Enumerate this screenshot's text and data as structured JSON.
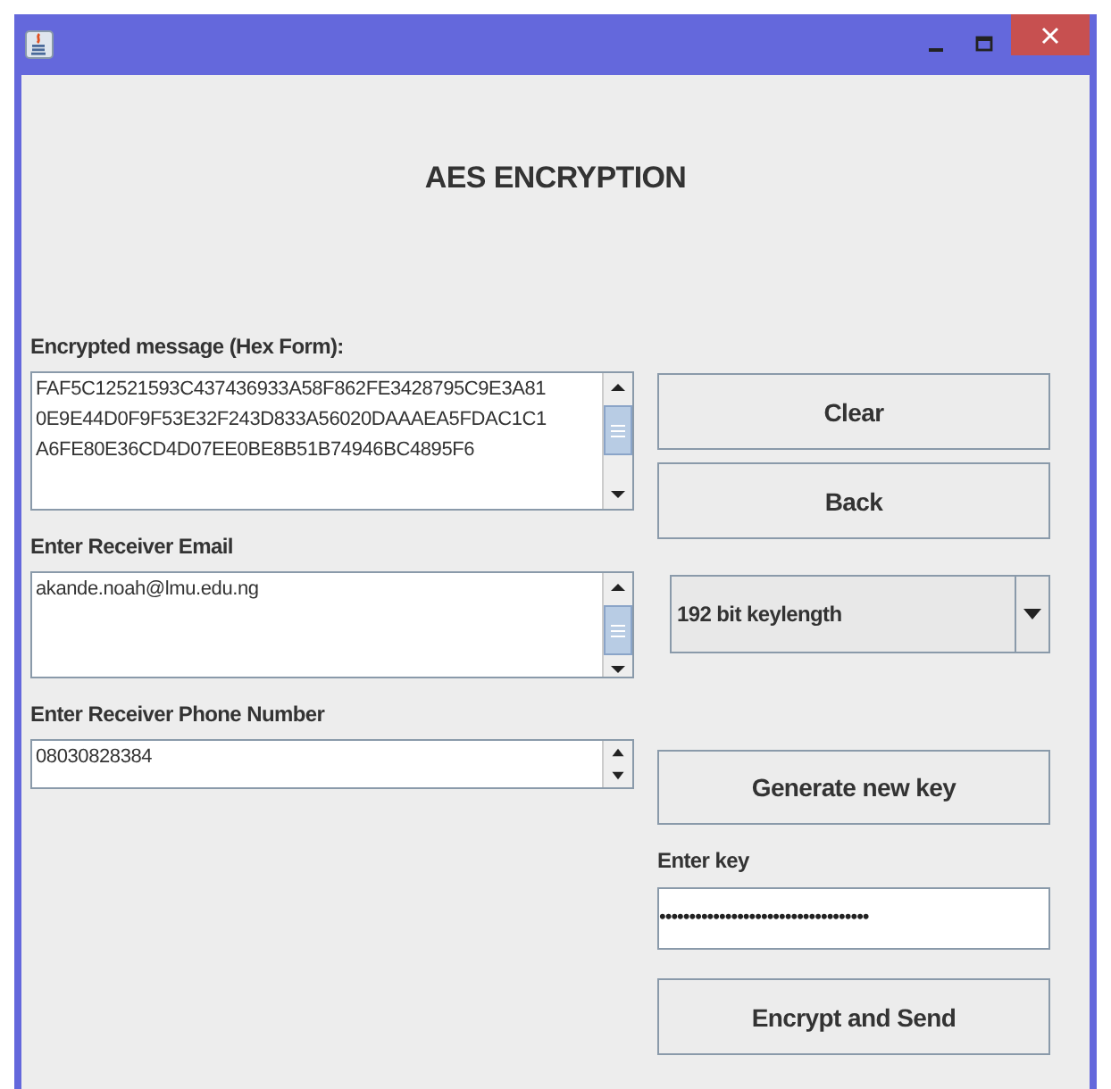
{
  "heading": "AES ENCRYPTION",
  "fields": [
    {
      "kind": "textarea",
      "label": "Encrypted message (Hex Form):",
      "lines": [
        "FAF5C12521593C437436933A58F862FE3428795C9E3A81",
        "0E9E44D0F9F53E32F243D833A56020DAAAEA5FDAC1C1",
        "A6FE80E36CD4D07EE0BE8B51B74946BC4895F6"
      ]
    },
    {
      "kind": "textarea",
      "label": "Enter Receiver Email",
      "lines": [
        "akande.noah@lmu.edu.ng"
      ]
    },
    {
      "kind": "spinner",
      "label": "Enter Receiver Phone Number",
      "lines": [
        "08030828384"
      ]
    }
  ],
  "buttons_top": [
    "Clear",
    "Back"
  ],
  "key_length": {
    "value": "192 bit keylength"
  },
  "generate_button": "Generate new key",
  "key": {
    "label": "Enter key",
    "masked_value": "•••••••••••••••••••••••••••••••••••"
  },
  "send_button": "Encrypt and Send"
}
